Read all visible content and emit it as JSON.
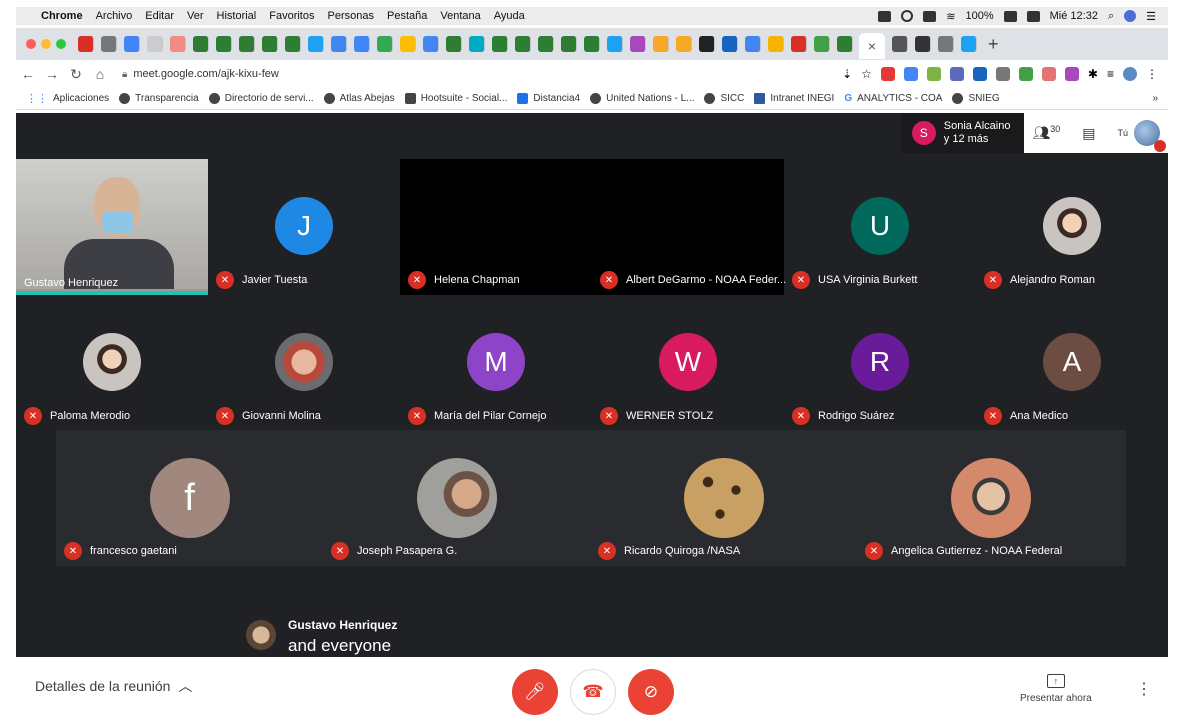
{
  "menubar": {
    "app": "Chrome",
    "items": [
      "Archivo",
      "Editar",
      "Ver",
      "Historial",
      "Favoritos",
      "Personas",
      "Pestaña",
      "Ventana",
      "Ayuda"
    ],
    "battery": "100%",
    "clock": "Mié 12:32"
  },
  "browser": {
    "url": "meet.google.com/ajk-kixu-few",
    "close_tab": "×",
    "new_tab": "+"
  },
  "bookmarks": [
    "Aplicaciones",
    "Transparencia",
    "Directorio de servi...",
    "Atlas Abejas",
    "Hootsuite - Social...",
    "Distancia4",
    "United Nations - L...",
    "SICC",
    "Intranet INEGI",
    "ANALYTICS - COA",
    "SNIEG"
  ],
  "bookmarks_more": "»",
  "meet": {
    "presenter": {
      "initial": "S",
      "name": "Sonia Alcaino",
      "more": "y 12 más"
    },
    "participants_count": "30",
    "me_label": "Tú",
    "tiles": [
      {
        "name": "Gustavo Henriquez",
        "type": "video"
      },
      {
        "name": "Javier Tuesta",
        "initial": "J",
        "color": "#1e88e5"
      },
      {
        "name": "Helena Chapman",
        "type": "black"
      },
      {
        "name": "Albert DeGarmo - NOAA Feder...",
        "type": "black"
      },
      {
        "name": "USA Virginia Burkett",
        "initial": "U",
        "color": "#00695c"
      },
      {
        "name": "Alejandro Roman",
        "type": "photo"
      },
      {
        "name": "Paloma Merodio",
        "type": "photo"
      },
      {
        "name": "Giovanni Molina",
        "type": "photo"
      },
      {
        "name": "María del Pilar Cornejo",
        "initial": "M",
        "color": "#8e44c9"
      },
      {
        "name": "WERNER STOLZ",
        "initial": "W",
        "color": "#d81b60"
      },
      {
        "name": "Rodrigo Suárez",
        "initial": "R",
        "color": "#6a1b9a"
      },
      {
        "name": "Ana Medico",
        "initial": "A",
        "color": "#6d4c41"
      },
      {
        "name": "francesco gaetani",
        "initial": "f",
        "color": "#a1887f"
      },
      {
        "name": "Joseph Pasapera G.",
        "type": "photo"
      },
      {
        "name": "Ricardo Quiroga /NASA",
        "type": "leopard"
      },
      {
        "name": "Angelica Gutierrez - NOAA Federal",
        "type": "photo"
      }
    ],
    "caption": {
      "speaker": "Gustavo Henriquez",
      "text": "and everyone"
    }
  },
  "bottom": {
    "details": "Detalles de la reunión",
    "present": "Presentar ahora"
  }
}
